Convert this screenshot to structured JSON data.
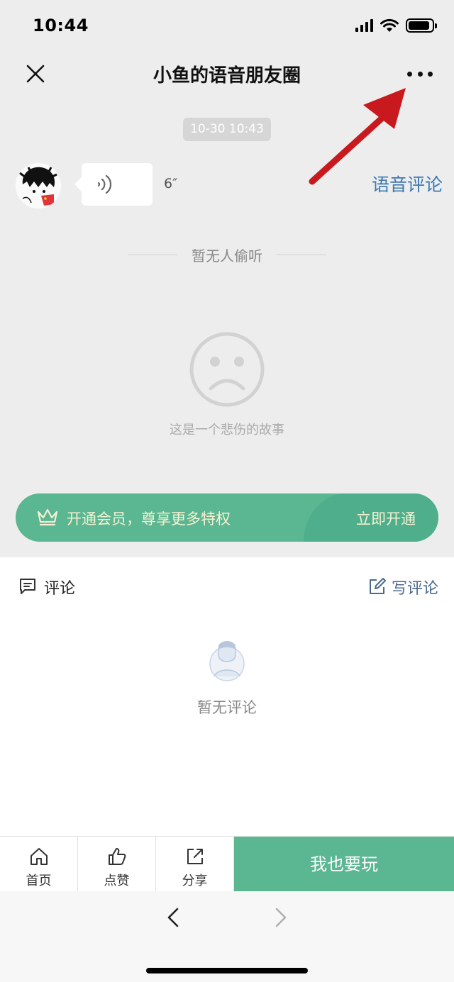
{
  "status_bar": {
    "time": "10:44",
    "battery_level": 0.9
  },
  "nav": {
    "title": "小鱼的语音朋友圈",
    "close_icon": "close-icon",
    "more_icon": "more-dots-icon"
  },
  "post": {
    "timestamp": "10-30 10:43",
    "voice_duration": "6″",
    "voice_comment_label": "语音评论",
    "listeners_label": "暂无人偷听",
    "empty_state_text": "这是一个悲伤的故事"
  },
  "vip_banner": {
    "text": "开通会员，尊享更多特权",
    "action": "立即开通"
  },
  "comments": {
    "title": "评论",
    "write_label": "写评论",
    "empty_text": "暂无评论"
  },
  "tabbar": {
    "home": "首页",
    "like": "点赞",
    "share": "分享",
    "play": "我也要玩"
  },
  "colors": {
    "accent_green": "#5bb692",
    "link_blue": "#3c78b4",
    "arrow_red": "#c8191e"
  }
}
